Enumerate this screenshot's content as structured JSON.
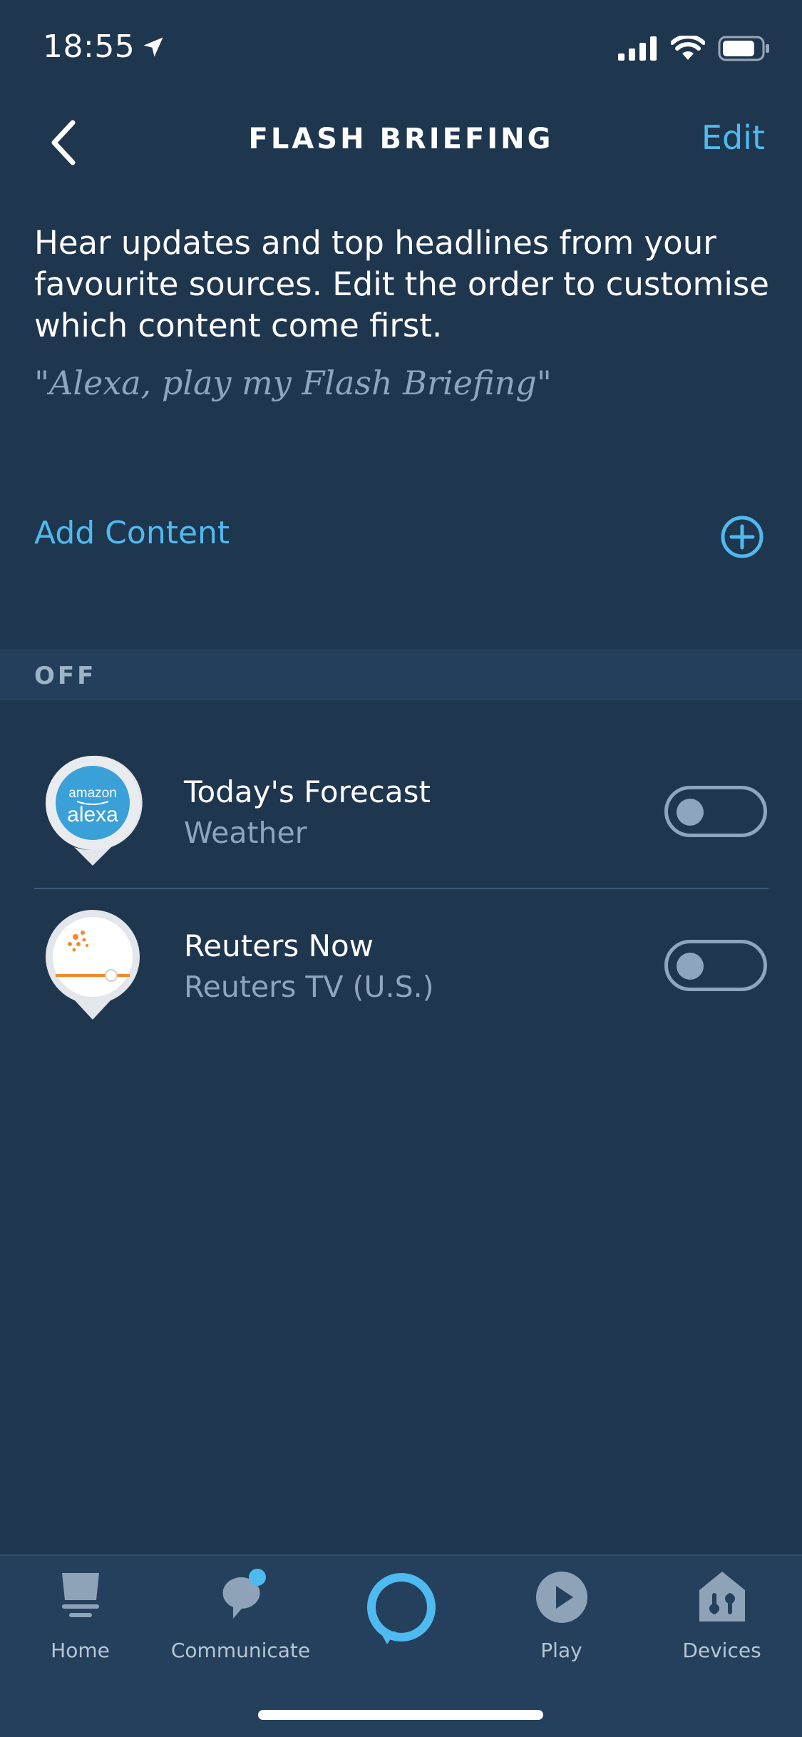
{
  "status": {
    "time": "18:55"
  },
  "header": {
    "title": "FLASH BRIEFING",
    "edit_label": "Edit"
  },
  "intro": {
    "description": "Hear updates and top headlines from your favourite sources. Edit the order to customise which content come first.",
    "quote": "\"Alexa, play my Flash Briefing\""
  },
  "add_content": {
    "label": "Add Content",
    "icon": "plus-circle-icon"
  },
  "section": {
    "label": "OFF"
  },
  "items": [
    {
      "name": "Today's Forecast",
      "source": "Weather",
      "icon": "alexa-logo",
      "enabled": false,
      "logo_top": "amazon",
      "logo_main": "alexa"
    },
    {
      "name": "Reuters Now",
      "source": "Reuters TV (U.S.)",
      "icon": "reuters-logo",
      "enabled": false
    }
  ],
  "tabs": [
    {
      "label": "Home",
      "icon": "home-icon"
    },
    {
      "label": "Communicate",
      "icon": "chat-icon"
    },
    {
      "label": "",
      "icon": "alexa-ring-icon"
    },
    {
      "label": "Play",
      "icon": "play-icon"
    },
    {
      "label": "Devices",
      "icon": "devices-icon"
    }
  ],
  "colors": {
    "background": "#1f364f",
    "accent": "#4fbaf0",
    "muted": "#8ea6bd"
  }
}
